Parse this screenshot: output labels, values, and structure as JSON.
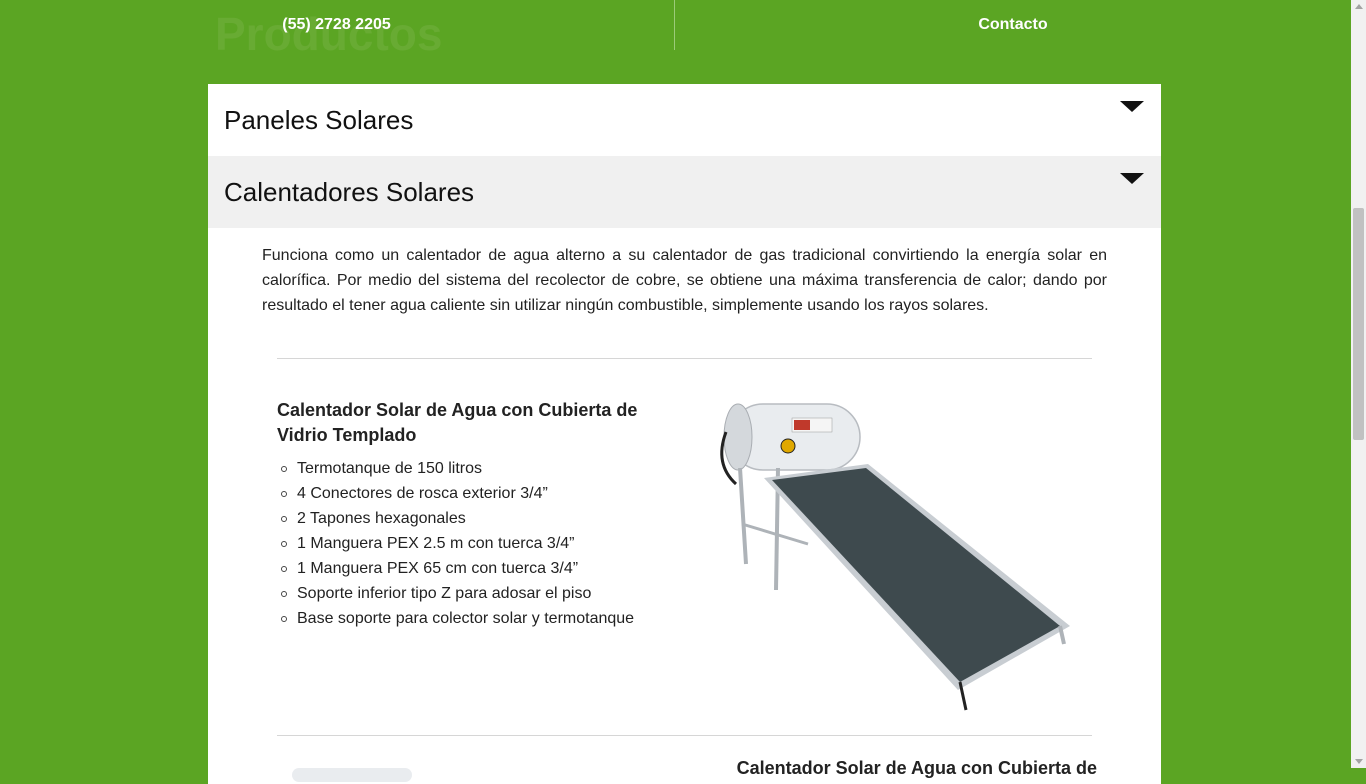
{
  "page": {
    "ghost_title": "Productos"
  },
  "topbar": {
    "phone": "(55) 2728 2205",
    "contact": "Contacto"
  },
  "accordion": [
    {
      "title": "Paneles Solares",
      "expanded": false
    },
    {
      "title": "Calentadores Solares",
      "expanded": true
    }
  ],
  "content": {
    "intro": "Funciona como un calentador de agua alterno a su calentador de gas tradicional convirtiendo la energía solar en calorífica. Por medio del sistema del recolector de cobre, se obtiene una máxima transferencia de calor; dando por resultado el tener agua caliente sin utilizar ningún combustible, simplemente usando los rayos solares.",
    "product": {
      "title": "Calentador Solar de Agua con Cubierta de Vidrio Templado",
      "features": [
        "Termotanque de 150 litros",
        "4 Conectores de rosca exterior 3/4”",
        "2 Tapones hexagonales",
        "1 Manguera PEX 2.5 m con tuerca 3/4”",
        "1 Manguera PEX 65 cm con tuerca 3/4”",
        "Soporte inferior tipo Z para adosar el piso",
        "Base soporte para colector solar y termotanque"
      ]
    },
    "next_product_title": "Calentador Solar de Agua con Cubierta de"
  },
  "colors": {
    "background": "#5ba523",
    "panel": "#ffffff",
    "active_header": "#f0f0f0"
  }
}
